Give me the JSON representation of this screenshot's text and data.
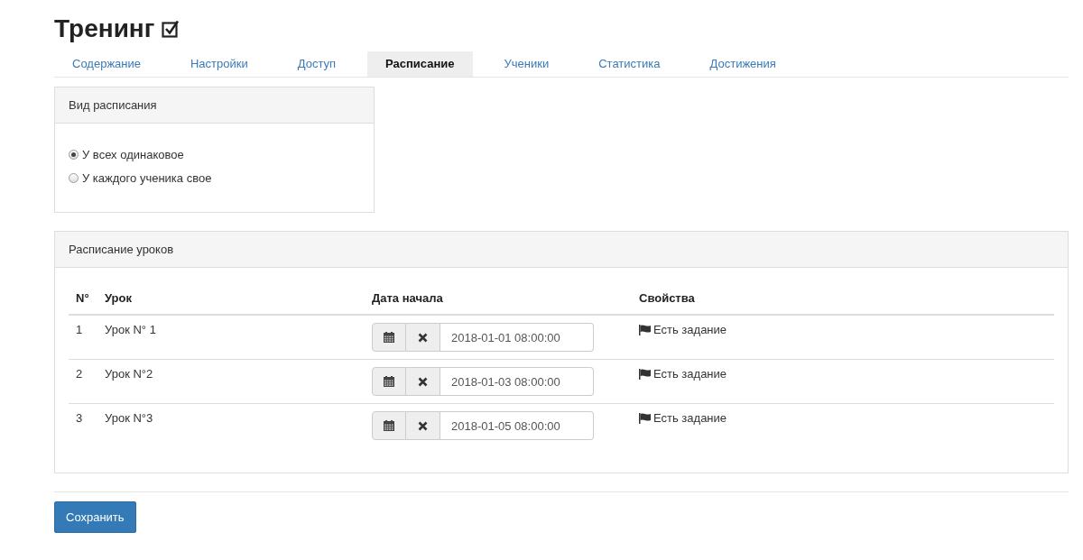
{
  "title": "Тренинг",
  "tabs": [
    {
      "label": "Содержание",
      "selected": false
    },
    {
      "label": "Настройки",
      "selected": false
    },
    {
      "label": "Доступ",
      "selected": false
    },
    {
      "label": "Расписание",
      "selected": true
    },
    {
      "label": "Ученики",
      "selected": false
    },
    {
      "label": "Статистика",
      "selected": false
    },
    {
      "label": "Достижения",
      "selected": false
    }
  ],
  "schedule_type": {
    "heading": "Вид расписания",
    "options": [
      {
        "label": "У всех одинаковое",
        "selected": true
      },
      {
        "label": "У каждого ученика свое",
        "selected": false
      }
    ]
  },
  "lessons": {
    "heading": "Расписание уроков",
    "columns": [
      "N°",
      "Урок",
      "Дата начала",
      "Свойства"
    ],
    "rows": [
      {
        "number": "1",
        "name": "Урок N° 1",
        "start": "2018-01-01 08:00:00",
        "property": "Есть задание"
      },
      {
        "number": "2",
        "name": "Урок N°2",
        "start": "2018-01-03 08:00:00",
        "property": "Есть задание"
      },
      {
        "number": "3",
        "name": "Урок N°3",
        "start": "2018-01-05 08:00:00",
        "property": "Есть задание"
      }
    ]
  },
  "save_button": "Сохранить"
}
